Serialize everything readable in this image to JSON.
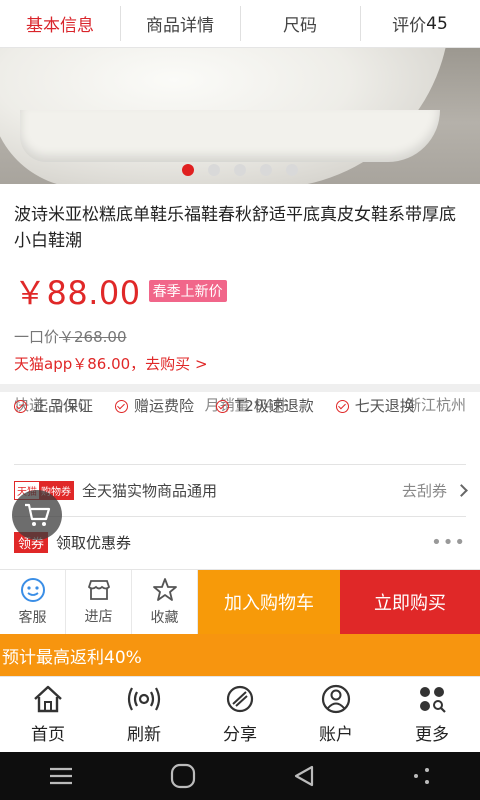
{
  "tabs": [
    {
      "label": "基本信息",
      "active": true
    },
    {
      "label": "商品详情",
      "active": false
    },
    {
      "label": "尺码",
      "active": false
    },
    {
      "label": "评价",
      "count": "45",
      "active": false
    }
  ],
  "carousel": {
    "total": 5,
    "active_index": 0
  },
  "product": {
    "title": "波诗米亚松糕底单鞋乐福鞋春秋舒适平底真皮女鞋系带厚底小白鞋潮",
    "price": "￥88.00",
    "promo_badge": "春季上新价",
    "original_label": "一口价",
    "original_price": "￥268.00",
    "app_price": "天猫app￥86.00，去购买 >",
    "shipping": "快递: 0.00",
    "monthly_sales": "月销量 94件",
    "location": "浙江杭州"
  },
  "guarantees": [
    "正品保证",
    "赠运费险",
    "T2极速退款",
    "七天退换"
  ],
  "coupon": {
    "badge_left": "天猫",
    "badge_right": "购物券",
    "text": "全天猫实物商品通用",
    "action": "去刮券"
  },
  "get_coupon": {
    "badge": "领券",
    "text": "领取优惠券",
    "more": "•••"
  },
  "actions": {
    "service": "客服",
    "store": "进店",
    "favorite": "收藏",
    "add_to_cart": "加入购物车",
    "buy_now": "立即购买"
  },
  "rebate": "预计最高返利40%",
  "bottom_nav": [
    "首页",
    "刷新",
    "分享",
    "账户",
    "更多"
  ],
  "colors": {
    "accent": "#e02828",
    "orange": "#f79a09",
    "rebate": "#f7950f"
  },
  "icons": [
    "service-icon",
    "store-icon",
    "star-icon",
    "home-icon",
    "refresh-icon",
    "share-icon",
    "account-icon",
    "more-icon",
    "cart-icon"
  ]
}
